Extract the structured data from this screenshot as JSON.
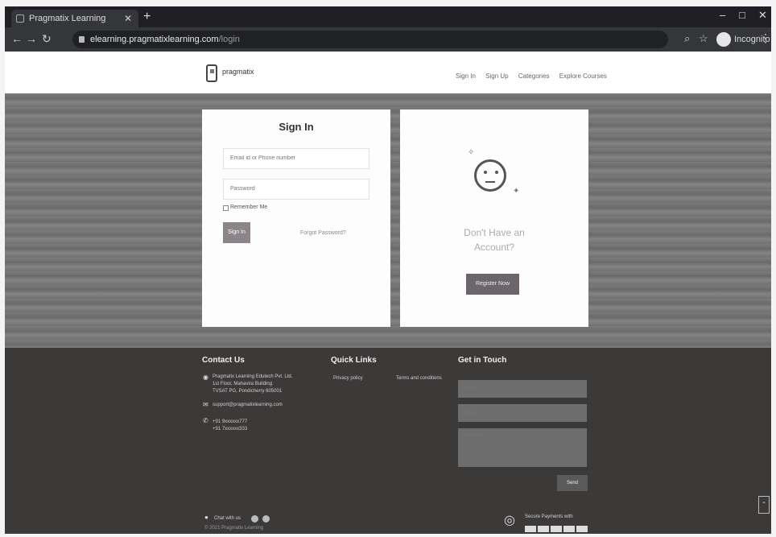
{
  "browser": {
    "tab_title": "Pragmatix Learning",
    "url_host": "elearning.pragmatixlearning.com",
    "url_path": "/login",
    "profile": "Incognito"
  },
  "header": {
    "logo_text": "pragmatix",
    "nav": [
      "Sign In",
      "Sign Up",
      "Categories",
      "Explore Courses"
    ]
  },
  "signin": {
    "title": "Sign In",
    "email_placeholder": "Email id or Phone number",
    "password_placeholder": "Password",
    "remember_label": "Remember Me",
    "signin_button": "Sign In",
    "forgot_link": "Forgot Password?"
  },
  "register": {
    "message_line1": "Don't Have an",
    "message_line2": "Account?",
    "register_button": "Register Now"
  },
  "footer": {
    "contact": {
      "heading": "Contact Us",
      "address_line1": "Pragmatix Learning Edutech Pvt. Ltd.",
      "address_line2": "1st Floor, Mahavira Building",
      "address_line3": "TVSAT PG, Pondicherry 605001",
      "email": "support@pragmatixlearning.com",
      "phone1": "+91 9xxxxxx777",
      "phone2": "+91 7xxxxxx333"
    },
    "quick_links": {
      "heading": "Quick Links",
      "links": [
        "Privacy policy",
        "Terms and conditions"
      ]
    },
    "get_in_touch": {
      "heading": "Get in Touch",
      "name_placeholder": "Name",
      "email_placeholder": "Email",
      "message_placeholder": "Message",
      "send_button": "Send"
    },
    "chat_label": "Chat with us",
    "copyright": "© 2021 Pragmatix Learning",
    "payments_label": "Secure Payments with"
  }
}
